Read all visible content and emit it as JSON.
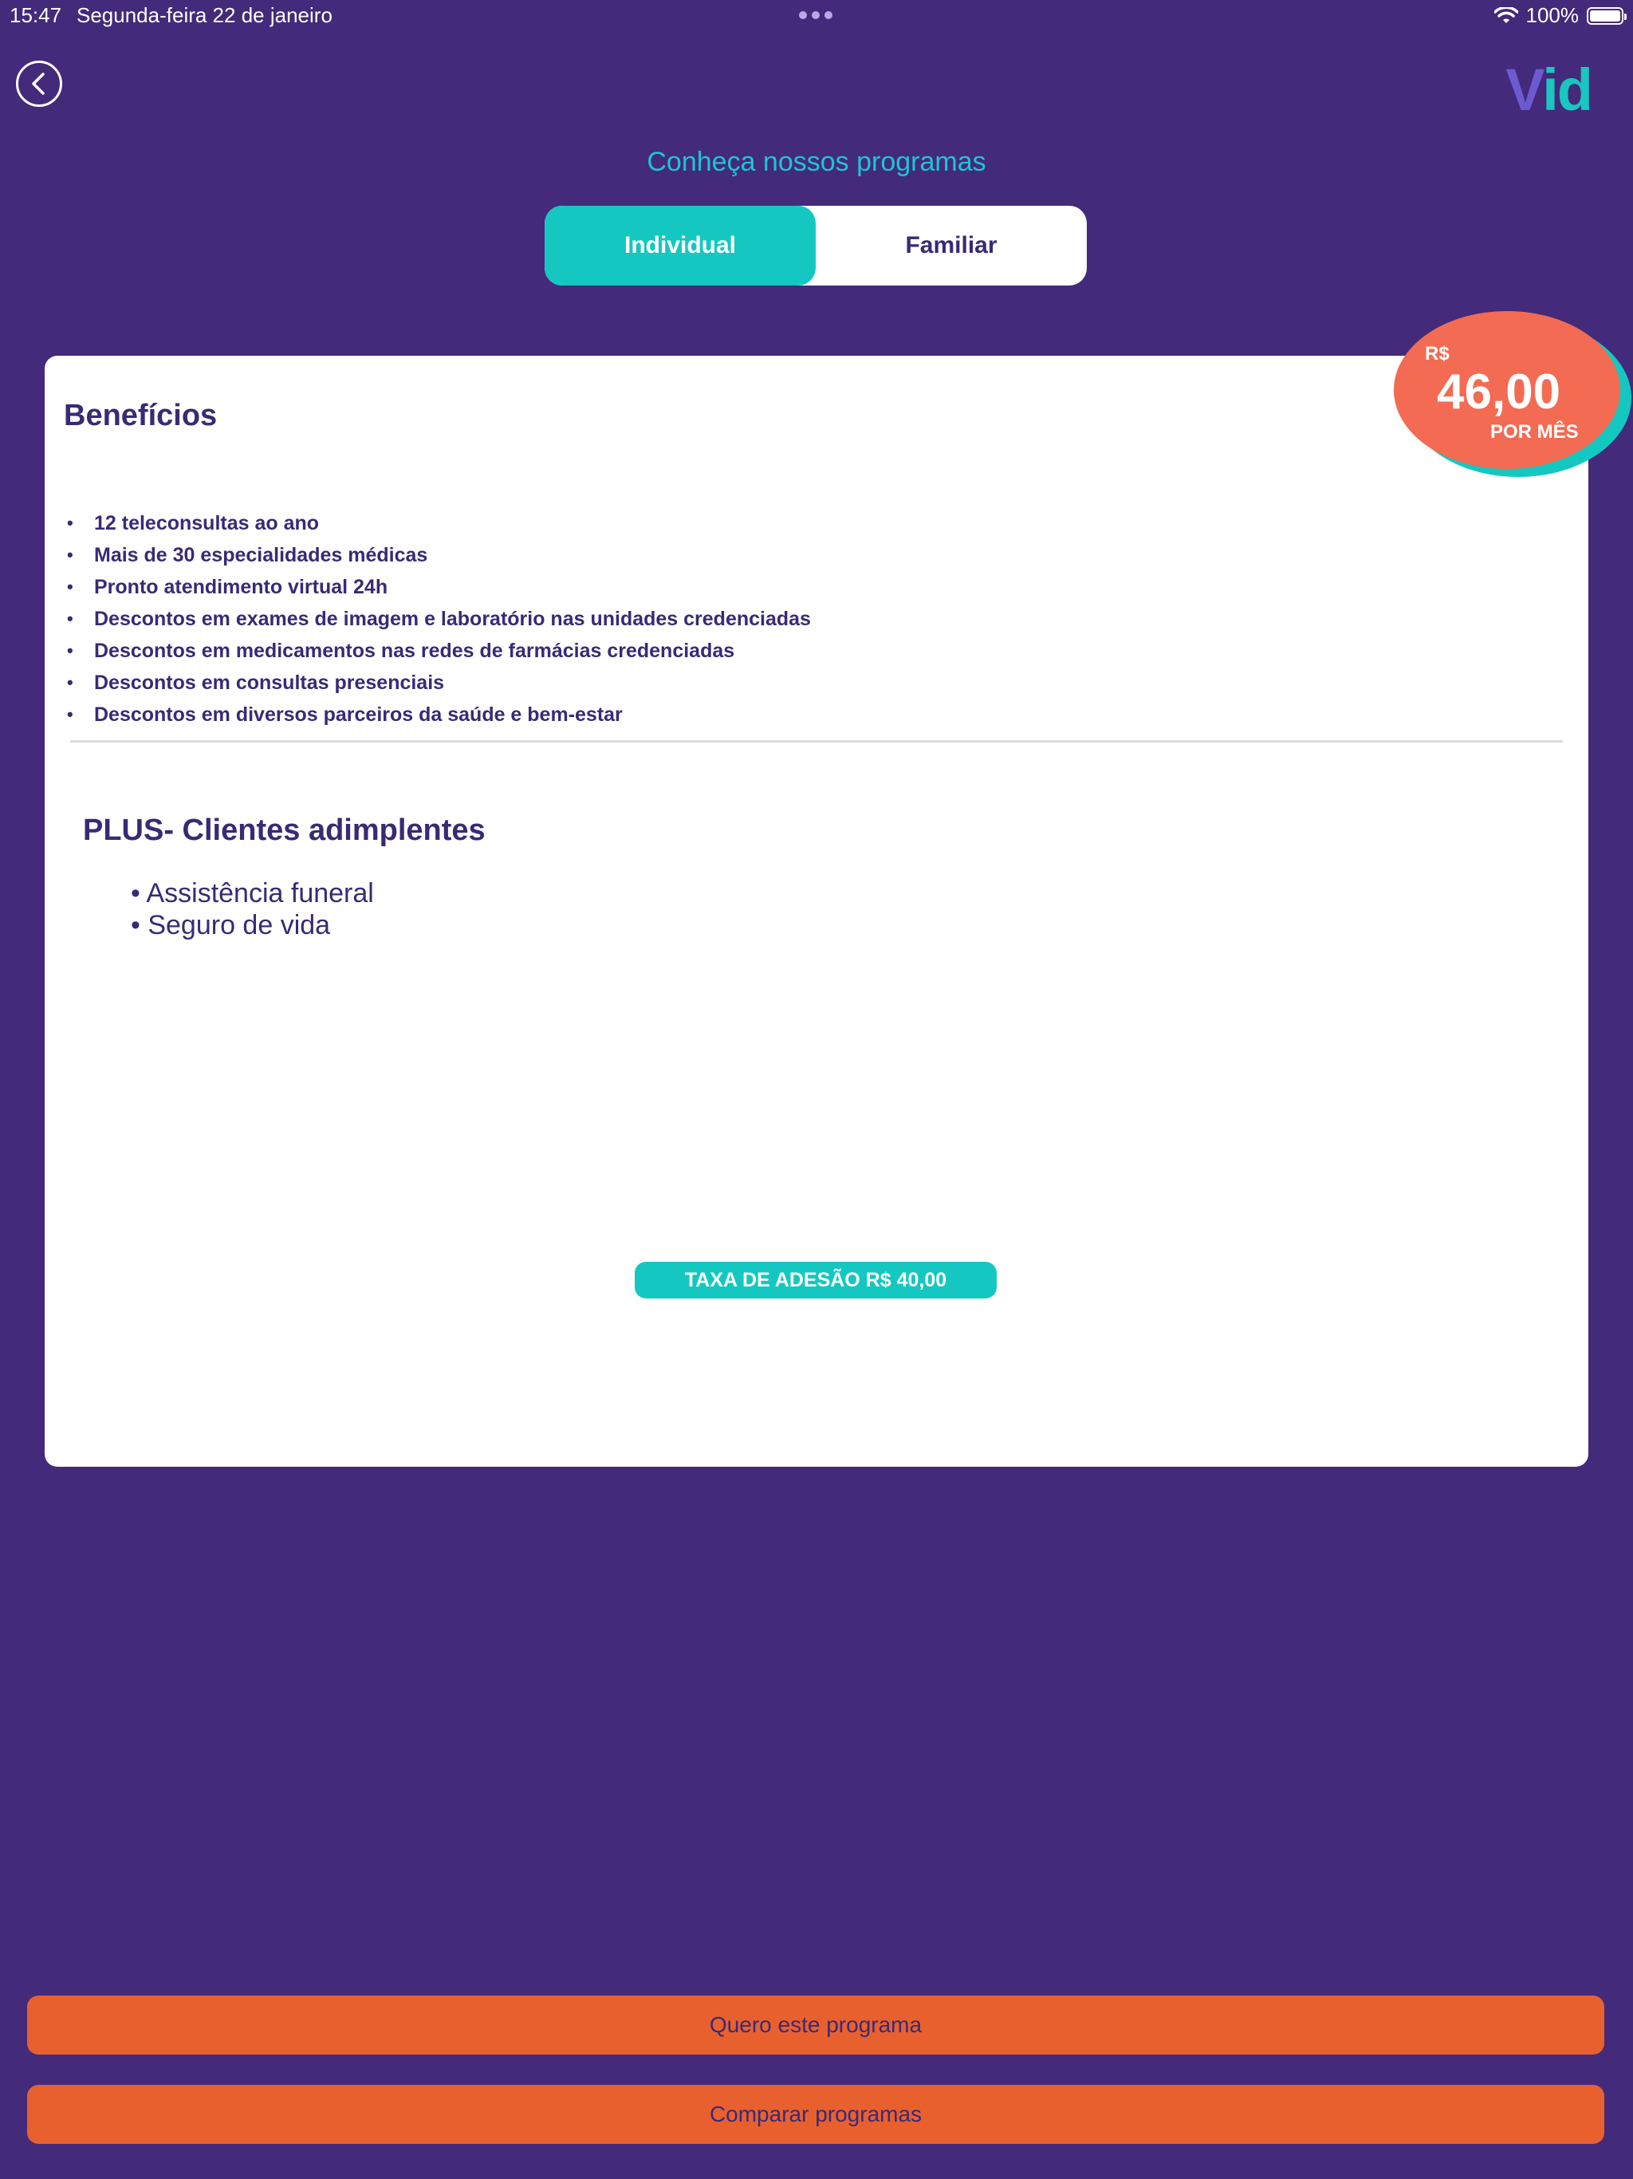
{
  "status_bar": {
    "time": "15:47",
    "date": "Segunda-feira 22 de janeiro",
    "battery": "100%"
  },
  "header": {
    "logo_first": "V",
    "logo_rest": "id",
    "title": "Conheça nossos programas"
  },
  "tabs": [
    {
      "label": "Individual",
      "active": true
    },
    {
      "label": "Familiar",
      "active": false
    }
  ],
  "price": {
    "currency": "R$",
    "value": "46,00",
    "period": "POR MÊS"
  },
  "benefits": {
    "title": "Benefícios",
    "items": [
      "12 teleconsultas ao ano",
      "Mais de 30 especialidades médicas",
      "Pronto atendimento virtual 24h",
      "Descontos em exames de imagem e laboratório nas unidades credenciadas",
      "Descontos em medicamentos nas redes de farmácias credenciadas",
      "Descontos em consultas presenciais",
      "Descontos em diversos parceiros da saúde e bem-estar"
    ]
  },
  "plus": {
    "title": "PLUS- Clientes adimplentes",
    "items": [
      "• Assistência funeral",
      "• Seguro de vida"
    ]
  },
  "fee": "TAXA DE ADESÃO R$ 40,00",
  "actions": {
    "primary": "Quero este programa",
    "secondary": "Comparar programas"
  },
  "colors": {
    "background": "#432a7a",
    "teal": "#14c8c1",
    "orange": "#e9602f",
    "coral": "#f26b52",
    "text_dark": "#3a2a74"
  }
}
